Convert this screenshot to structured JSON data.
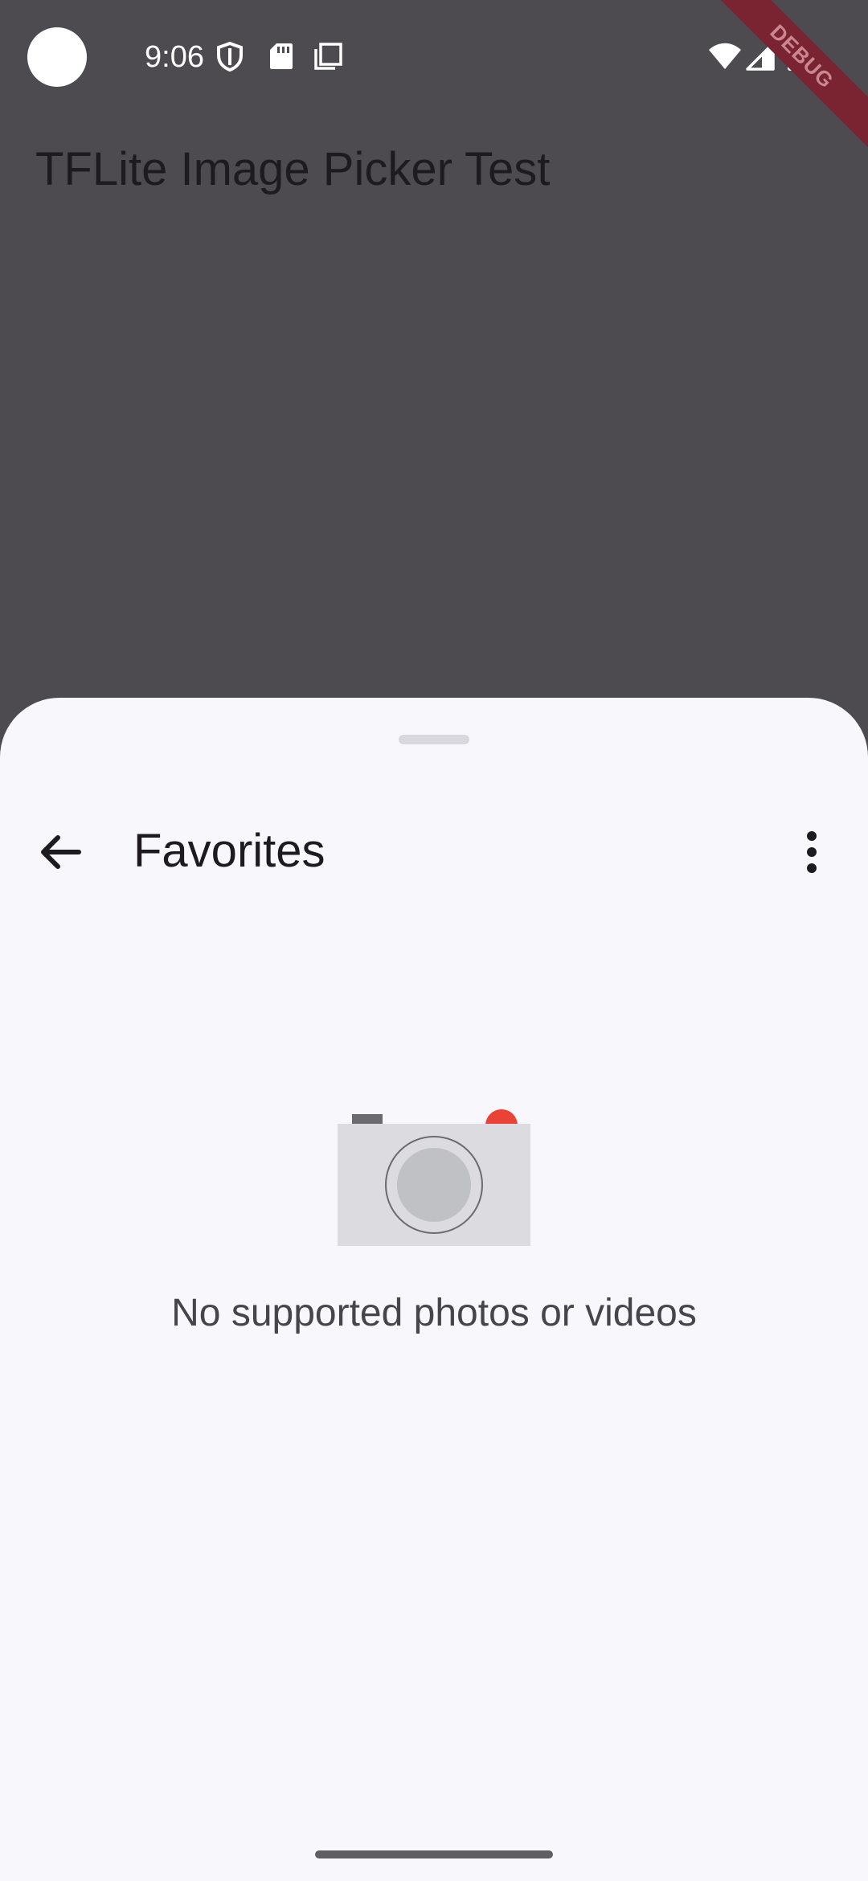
{
  "status_bar": {
    "time": "9:06",
    "icons": [
      "camera-cutout",
      "shield-icon",
      "sd-card-icon",
      "screenshot-icon",
      "wifi-icon",
      "signal-icon",
      "battery-icon"
    ]
  },
  "debug_banner": {
    "label": "DEBUG"
  },
  "app": {
    "title": "TFLite Image Picker Test"
  },
  "picker_sheet": {
    "title": "Favorites",
    "back_icon": "arrow-back-icon",
    "menu_icon": "more-vert-icon",
    "empty_message": "No supported photos or videos",
    "empty_illustration": "camera-illustration"
  },
  "colors": {
    "scrim": "#4d4b4f",
    "sheet_background": "#f8f7fc",
    "debug_banner": "#7a2331",
    "camera_record_dot": "#ea4335"
  }
}
